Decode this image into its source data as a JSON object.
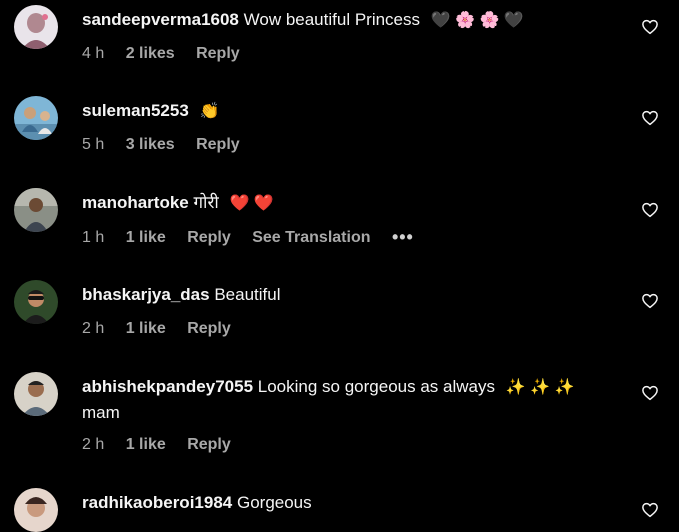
{
  "comments": [
    {
      "username": "sandeepverma1608",
      "text": "Wow beautiful Princess",
      "emojis": "🖤 🌸 🌸 🖤",
      "time": "4 h",
      "likes": "2 likes",
      "reply": "Reply"
    },
    {
      "username": "suleman5253",
      "text": "",
      "emojis": "👏",
      "time": "5 h",
      "likes": "3 likes",
      "reply": "Reply"
    },
    {
      "username": "manohartoke",
      "text": "गोरी",
      "emojis": "❤️ ❤️",
      "time": "1 h",
      "likes": "1 like",
      "reply": "Reply",
      "translation": "See Translation",
      "more": "•••"
    },
    {
      "username": "bhaskarjya_das",
      "text": "Beautiful",
      "emojis": "",
      "time": "2 h",
      "likes": "1 like",
      "reply": "Reply"
    },
    {
      "username": "abhishekpandey7055",
      "text": "Looking so gorgeous as always",
      "emojis": "✨ ✨ ✨",
      "text2": "mam",
      "time": "2 h",
      "likes": "1 like",
      "reply": "Reply"
    },
    {
      "username": "radhikaoberoi1984",
      "text": "Gorgeous",
      "emojis": ""
    }
  ],
  "icons": {
    "like": "heart-outline-icon",
    "more": "more-horizontal-icon"
  },
  "colors": {
    "background": "#000000",
    "primary_text": "#f5f5f5",
    "secondary_text": "#a8a8a8"
  }
}
